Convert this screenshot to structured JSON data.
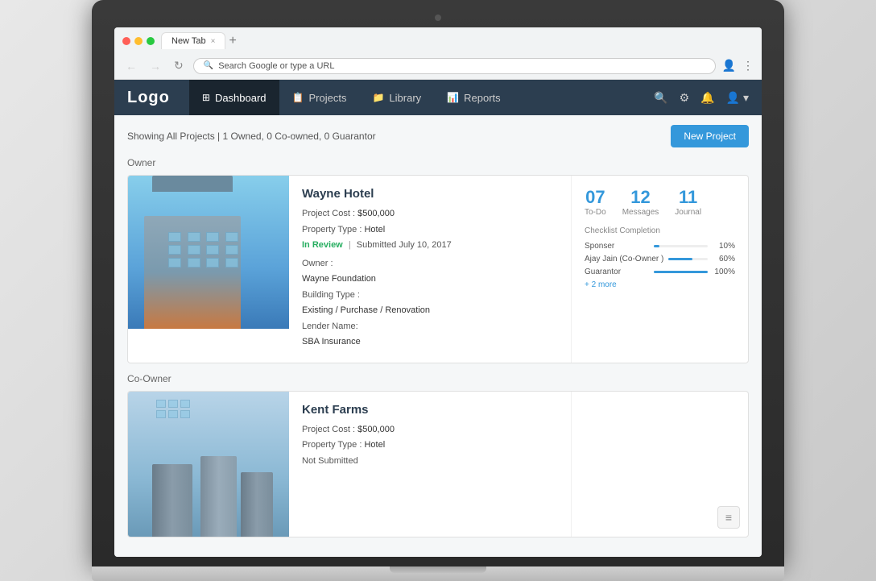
{
  "browser": {
    "tab_title": "New Tab",
    "tab_close": "×",
    "new_tab": "+",
    "address": "Search Google or type a URL",
    "nav_back": "←",
    "nav_forward": "→",
    "nav_refresh": "↻"
  },
  "app": {
    "logo": "Logo",
    "nav": [
      {
        "id": "dashboard",
        "label": "Dashboard",
        "icon": "⊞",
        "active": true
      },
      {
        "id": "projects",
        "label": "Projects",
        "icon": "📋",
        "active": false
      },
      {
        "id": "library",
        "label": "Library",
        "icon": "📁",
        "active": false
      },
      {
        "id": "reports",
        "label": "Reports",
        "icon": "📊",
        "active": false
      }
    ],
    "header_actions": {
      "search": "🔍",
      "settings": "⚙",
      "notifications": "🔔",
      "user": "👤"
    }
  },
  "content": {
    "showing_text": "Showing All Projects  |  1 Owned, 0 Co-owned, 0 Guarantor",
    "new_project_btn": "New Project",
    "sections": [
      {
        "label": "Owner",
        "projects": [
          {
            "name": "Wayne Hotel",
            "cost_label": "Project Cost :",
            "cost_value": "$500,000",
            "type_label": "Property Type :",
            "type_value": "Hotel",
            "status": "In Review",
            "submitted": "Submitted  July 10, 2017",
            "owner_label": "Owner :",
            "owner_value": "Wayne Foundation",
            "building_label": "Building Type :",
            "building_value": "Existing / Purchase / Renovation",
            "lender_label": "Lender Name:",
            "lender_value": "SBA Insurance",
            "stats": {
              "todo": {
                "number": "07",
                "label": "To-Do"
              },
              "messages": {
                "number": "12",
                "label": "Messages"
              },
              "journal": {
                "number": "11",
                "label": "Journal"
              }
            },
            "checklist_title": "Checklist Completion",
            "checklist": [
              {
                "name": "Sponser",
                "pct": 10
              },
              {
                "name": "Ajay Jain (Co-Owner )",
                "pct": 60
              },
              {
                "name": "Guarantor",
                "pct": 100
              }
            ],
            "more_text": "+ 2 more"
          }
        ]
      },
      {
        "label": "Co-Owner",
        "projects": [
          {
            "name": "Kent Farms",
            "cost_label": "Project Cost :",
            "cost_value": "$500,000",
            "type_label": "Property Type :",
            "type_value": "Hotel",
            "status": "Not Submitted",
            "owner_label": "",
            "owner_value": "",
            "building_label": "",
            "building_value": "",
            "lender_label": "",
            "lender_value": ""
          }
        ]
      }
    ]
  }
}
